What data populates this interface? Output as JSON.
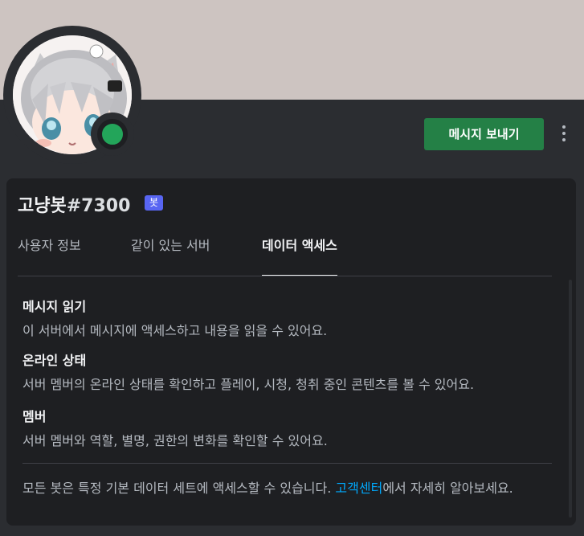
{
  "profile": {
    "username": "고냥봇",
    "discriminator": "#7300",
    "bot_tag": "봇",
    "status": "online",
    "status_color": "#23a55a",
    "banner_color": "#cdc4c1"
  },
  "actions": {
    "send_message_label": "메시지 보내기",
    "more_icon": "more-vertical-icon"
  },
  "tabs": [
    {
      "label": "사용자 정보",
      "active": false
    },
    {
      "label": "같이 있는 서버",
      "active": false
    },
    {
      "label": "데이터 액세스",
      "active": true
    }
  ],
  "permissions": [
    {
      "title": "메시지 읽기",
      "description": "이 서버에서 메시지에 액세스하고 내용을 읽을 수 있어요."
    },
    {
      "title": "온라인 상태",
      "description": "서버 멤버의 온라인 상태를 확인하고 플레이, 시청, 청취 중인 콘텐츠를 볼 수 있어요."
    },
    {
      "title": "멤버",
      "description": "서버 멤버와 역할, 별명, 권한의 변화를 확인할 수 있어요."
    }
  ],
  "footer": {
    "text_before": "모든 봇은 특정 기본 데이터 세트에 액세스할 수 있습니다. ",
    "link_label": "고객센터",
    "text_after": "에서 자세히 알아보세요.",
    "link_color": "#00a8fc"
  }
}
